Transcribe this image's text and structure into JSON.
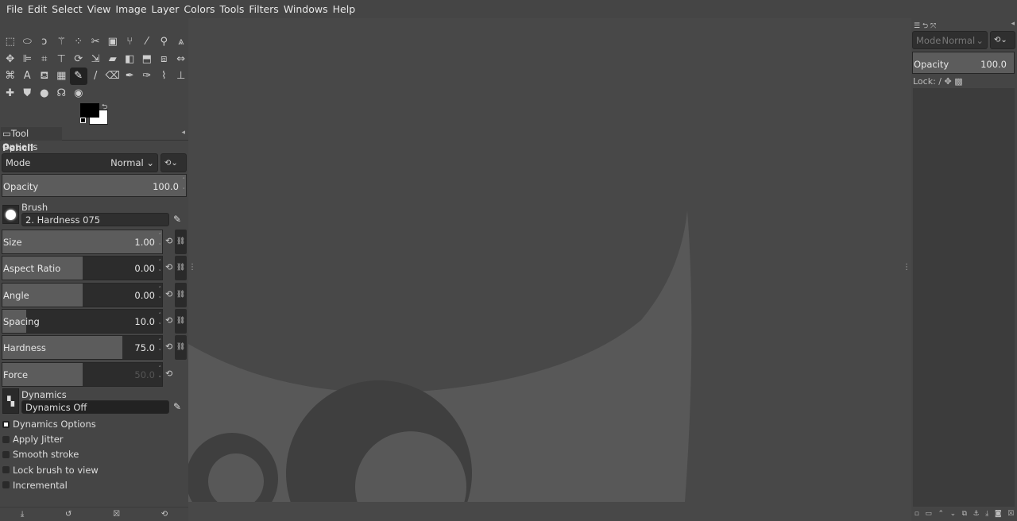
{
  "menu": [
    "File",
    "Edit",
    "Select",
    "View",
    "Image",
    "Layer",
    "Colors",
    "Tools",
    "Filters",
    "Windows",
    "Help"
  ],
  "toolbox": {
    "icons": [
      "rect-select-icon",
      "ellipse-select-icon",
      "free-select-icon",
      "fuzzy-select-icon",
      "select-by-color-icon",
      "scissors-icon",
      "foreground-select-icon",
      "paths-icon",
      "color-picker-icon",
      "zoom-icon",
      "measure-icon",
      "move-icon",
      "align-icon",
      "crop-icon",
      "unified-transform-icon",
      "rotate-icon",
      "scale-icon",
      "shear-icon",
      "flip-icon",
      "perspective-icon",
      "3d-transform-icon",
      "cage-icon",
      "warp-icon",
      "text-icon",
      "bucket-fill-icon",
      "gradient-icon",
      "pencil-icon",
      "paintbrush-icon",
      "eraser-icon",
      "airbrush-icon",
      "ink-icon",
      "mypaint-brush-icon",
      "clone-icon",
      "heal-icon",
      "perspective-clone-icon",
      "blur-icon",
      "smudge-icon",
      "dodge-burn-icon"
    ],
    "glyphs": [
      "⬚",
      "⬭",
      "ↄ",
      "⚚",
      "⁘",
      "✂",
      "▣",
      "⑂",
      "⁄",
      "⚲",
      "⩓",
      "✥",
      "⊫",
      "⌗",
      "⊤",
      "⟳",
      "⇲",
      "▰",
      "◧",
      "⬒",
      "⧈",
      "⇔",
      "⌘",
      "A",
      "⛾",
      "▦",
      "✎",
      "/",
      "⌫",
      "✒",
      "✑",
      "⌇",
      "⊥",
      "✚",
      "⛊",
      "●",
      "☊",
      "◉"
    ],
    "active_index": 26
  },
  "tool_options": {
    "tab_label": "Tool Options",
    "tool_name": "Pencil",
    "mode_label": "Mode",
    "mode_value": "Normal",
    "opacity": {
      "label": "Opacity",
      "value": "100.0"
    },
    "brush": {
      "label": "Brush",
      "value": "2. Hardness 075"
    },
    "sliders": [
      {
        "label": "Size",
        "value": "1.00",
        "fraction": 1.0
      },
      {
        "label": "Aspect Ratio",
        "value": "0.00",
        "fraction": 0.5
      },
      {
        "label": "Angle",
        "value": "0.00",
        "fraction": 0.5
      },
      {
        "label": "Spacing",
        "value": "10.0",
        "fraction": 0.15
      },
      {
        "label": "Hardness",
        "value": "75.0",
        "fraction": 0.75
      },
      {
        "label": "Force",
        "value": "50.0",
        "fraction": 0.5
      }
    ],
    "dynamics": {
      "label": "Dynamics",
      "value": "Dynamics Off"
    },
    "dynamics_options": "Dynamics Options",
    "checks": [
      {
        "label": "Apply Jitter",
        "checked": false
      },
      {
        "label": "Smooth stroke",
        "checked": false
      },
      {
        "label": "Lock brush to view",
        "checked": false
      },
      {
        "label": "Incremental",
        "checked": false
      }
    ]
  },
  "layers": {
    "mode_label": "Mode",
    "mode_value": "Normal",
    "opacity_label": "Opacity",
    "opacity_value": "100.0",
    "lock_label": "Lock:"
  }
}
